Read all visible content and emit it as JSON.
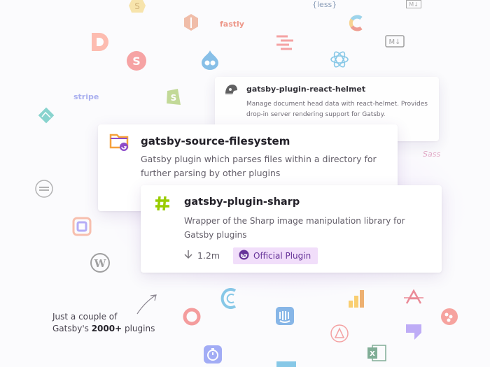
{
  "cards": {
    "helmet": {
      "title": "gatsby-plugin-react-helmet",
      "description": "Manage document head data with react-helmet. Provides drop-in server rendering support for Gatsby."
    },
    "filesystem": {
      "title": "gatsby-source-filesystem",
      "description": "Gatsby plugin which parses files within a directory for further parsing by other plugins"
    },
    "sharp": {
      "title": "gatsby-plugin-sharp",
      "description": "Wrapper of the Sharp image manipulation library for Gatsby plugins",
      "downloads": "1.2m",
      "badge": "Official Plugin"
    }
  },
  "caption": {
    "line1": "Just a couple of",
    "line2_prefix": "Gatsby's ",
    "line2_bold": "2000+",
    "line2_suffix": " plugins"
  },
  "logo_texts": {
    "less": "{less}",
    "fastly": "fastly",
    "stripe": "stripe",
    "markdown": "M↓",
    "sass": "Sass"
  },
  "colors": {
    "brand_purple": "#663399",
    "badge_bg": "#f1defa",
    "sharp_green": "#99cc00"
  },
  "icons": [
    "dollar-icon",
    "magento-icon",
    "less-logo",
    "fastly-logo",
    "contentful-icon",
    "markdown-icon",
    "dev-d-icon",
    "s-circle-icon",
    "drupal-icon",
    "squiggle-icon",
    "react-helmet-icon",
    "shopify-icon",
    "stripe-logo",
    "mountain-icon",
    "sanity-icon",
    "wordpress-icon",
    "prismic-icon",
    "sass-logo",
    "folder-icon",
    "hash-icon",
    "download-arrow-icon",
    "gatsby-icon",
    "arrow-icon",
    "ring-icon",
    "wave-icon",
    "intercom-icon",
    "bars-chart-icon",
    "a-icon",
    "dots-icon",
    "timer-icon",
    "lock-circle-icon",
    "excel-icon",
    "checkmark-icon"
  ]
}
